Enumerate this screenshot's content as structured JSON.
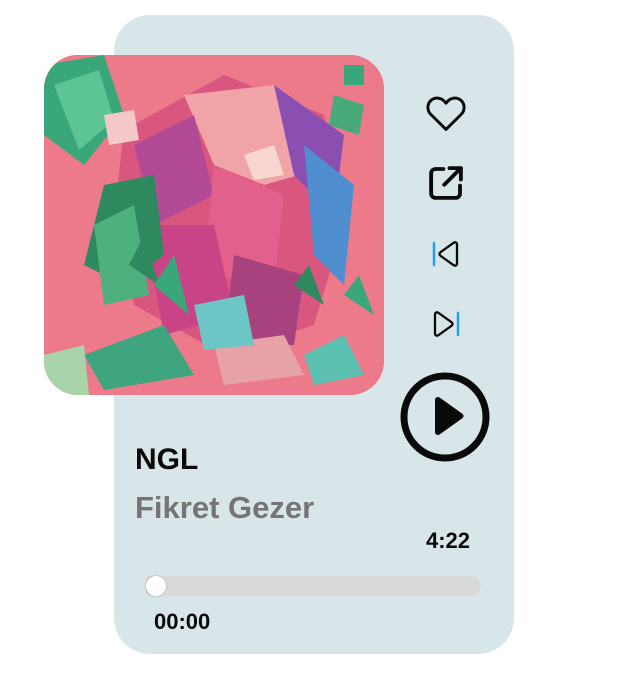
{
  "song": {
    "title": "NGL",
    "artist": "Fikret Gezer",
    "duration": "4:22",
    "current_time": "00:00",
    "progress": 0.03
  },
  "controls": [
    {
      "name": "like-button",
      "icon": "heart-icon"
    },
    {
      "name": "share-button",
      "icon": "external-link-icon"
    },
    {
      "name": "previous-button",
      "icon": "skip-back-icon"
    },
    {
      "name": "next-button",
      "icon": "skip-forward-icon"
    },
    {
      "name": "play-button",
      "icon": "play-icon"
    }
  ],
  "colors": {
    "card_background": "#d9e6e9",
    "accent": "#1ea1f2",
    "cover_background": "#ec7a8a",
    "artist_text": "#757575"
  }
}
